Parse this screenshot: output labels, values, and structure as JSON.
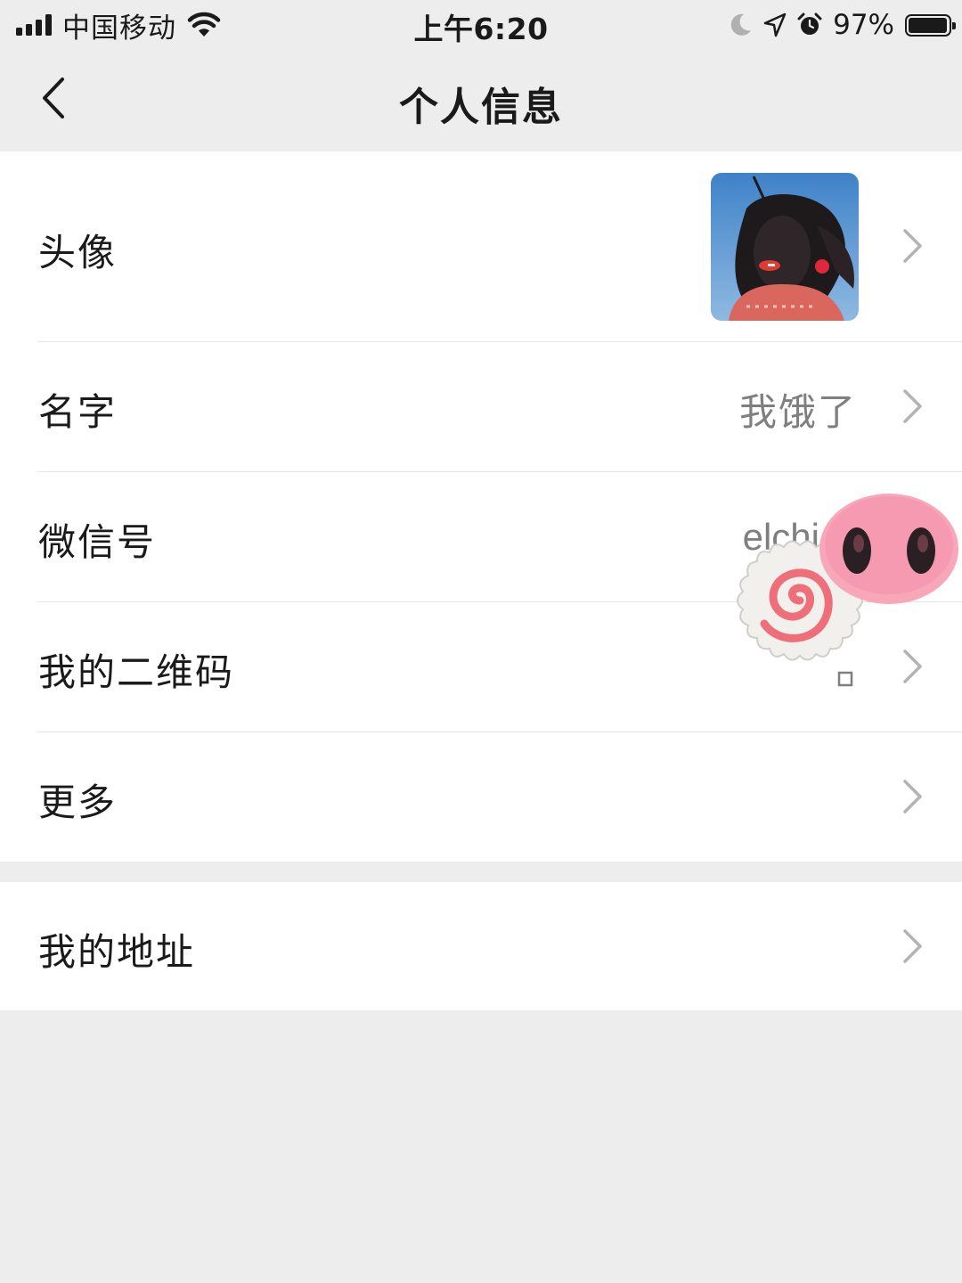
{
  "status_bar": {
    "carrier": "中国移动",
    "time": "上午6:20",
    "battery": "97%",
    "battery_level": 0.97
  },
  "nav": {
    "title": "个人信息"
  },
  "rows": [
    {
      "label": "头像",
      "value": ""
    },
    {
      "label": "名字",
      "value": "我饿了"
    },
    {
      "label": "微信号",
      "value": "elchi"
    },
    {
      "label": "我的二维码",
      "value": ""
    },
    {
      "label": "更多",
      "value": ""
    }
  ],
  "address_row": {
    "label": "我的地址"
  },
  "icons": {
    "signal": "signal-bars-icon",
    "wifi": "wifi-icon",
    "moon": "moon-icon",
    "location": "location-arrow-icon",
    "alarm": "alarm-icon",
    "battery": "battery-icon",
    "back": "back-chevron-icon",
    "chevron": "chevron-right-icon"
  },
  "colors": {
    "background": "#ededed",
    "cell": "#ffffff",
    "label": "#1a1a1a",
    "secondary": "#7f7f7f",
    "chevron": "#b3b3b3",
    "divider": "#e5e5e5"
  }
}
